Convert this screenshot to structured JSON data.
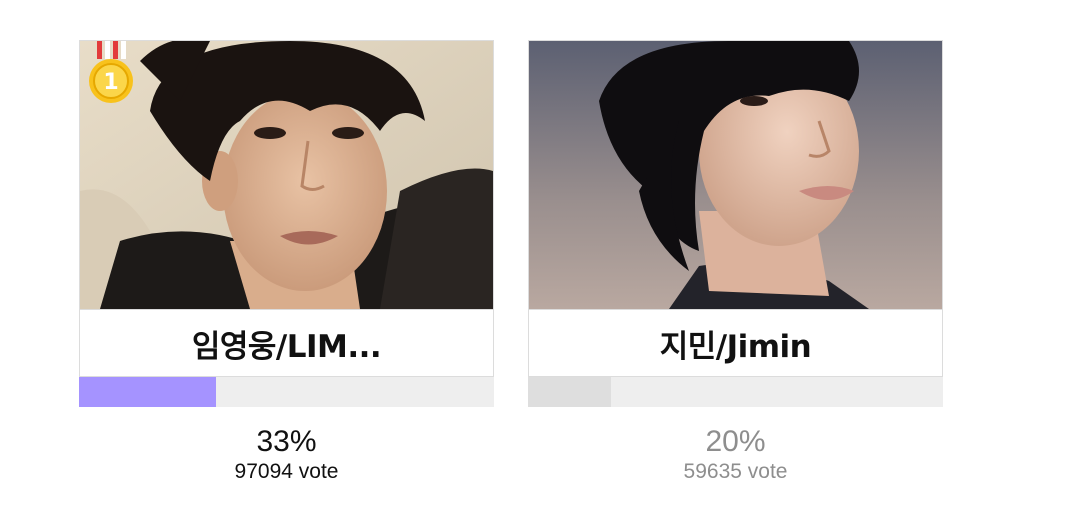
{
  "candidates": [
    {
      "name": "임영웅/LIM...",
      "percent": "33%",
      "percent_value": 33,
      "votes": "97094 vote",
      "rank_badge": "1",
      "bar_color": "#a593ff",
      "photo": "portrait-lim-young-woong"
    },
    {
      "name": "지민/Jimin",
      "percent": "20%",
      "percent_value": 20,
      "votes": "59635 vote",
      "bar_color": "#dedede",
      "photo": "portrait-jimin"
    }
  ],
  "icons": {
    "medal": "gold-medal-icon"
  }
}
